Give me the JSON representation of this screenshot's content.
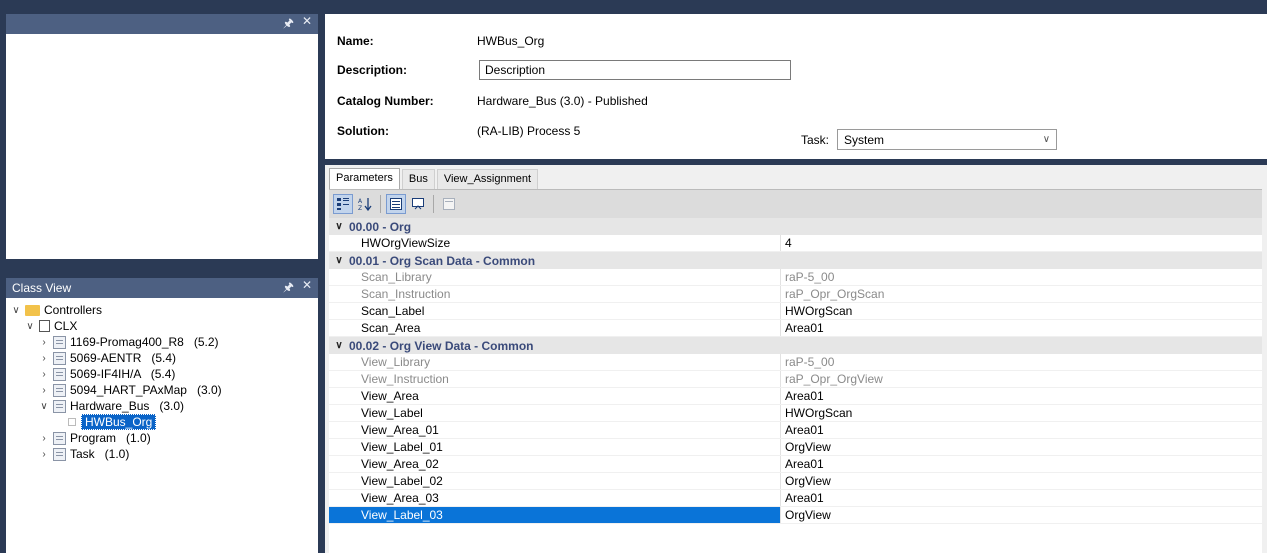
{
  "left_top_pane": {
    "pin": "ₕ",
    "close": "✕"
  },
  "class_view": {
    "title": "Class View",
    "pin": "ₕ",
    "close": "✕",
    "tree": [
      {
        "label": "Controllers",
        "level": 0,
        "expander": "∨",
        "icon": "folder-icon"
      },
      {
        "label": "CLX",
        "level": 1,
        "expander": "∨",
        "icon": "controller-icon"
      },
      {
        "label": "1169-Promag400_R8   (5.2)",
        "level": 2,
        "expander": "›",
        "icon": "module-icon"
      },
      {
        "label": "5069-AENTR   (5.4)",
        "level": 2,
        "expander": "›",
        "icon": "module-icon"
      },
      {
        "label": "5069-IF4IH/A   (5.4)",
        "level": 2,
        "expander": "›",
        "icon": "module-icon"
      },
      {
        "label": "5094_HART_PAxMap   (3.0)",
        "level": 2,
        "expander": "›",
        "icon": "module-icon"
      },
      {
        "label": "Hardware_Bus   (3.0)",
        "level": 2,
        "expander": "∨",
        "icon": "module-icon"
      },
      {
        "label": "HWBus_Org",
        "level": 3,
        "expander": "",
        "icon": "instance-icon",
        "selected": true
      },
      {
        "label": "Program   (1.0)",
        "level": 2,
        "expander": "›",
        "icon": "module-icon"
      },
      {
        "label": "Task   (1.0)",
        "level": 2,
        "expander": "›",
        "icon": "module-icon"
      }
    ]
  },
  "header": {
    "name_label": "Name:",
    "name_value": "HWBus_Org",
    "description_label": "Description:",
    "description_value": "Description",
    "catalog_label": "Catalog Number:",
    "catalog_value": "Hardware_Bus   (3.0)  - Published",
    "solution_label": "Solution:",
    "solution_value": "(RA-LIB) Process 5",
    "task_label": "Task:",
    "task_value": "System",
    "task_arrow": "∨"
  },
  "tabs": [
    "Parameters",
    "Bus",
    "View_Assignment"
  ],
  "toolbar": {
    "categorized": "∷",
    "alphabetical": "↓",
    "properties": "▤",
    "events": "↩",
    "pages": "□"
  },
  "parameters": [
    {
      "category": "00.00 - Org",
      "rows": [
        {
          "name": "HWOrgViewSize",
          "value": "4",
          "readonly": false
        }
      ]
    },
    {
      "category": "00.01 - Org Scan Data - Common",
      "rows": [
        {
          "name": "Scan_Library",
          "value": "raP-5_00",
          "readonly": true
        },
        {
          "name": "Scan_Instruction",
          "value": "raP_Opr_OrgScan",
          "readonly": true
        },
        {
          "name": "Scan_Label",
          "value": "HWOrgScan",
          "readonly": false
        },
        {
          "name": "Scan_Area",
          "value": "Area01",
          "readonly": false
        }
      ]
    },
    {
      "category": "00.02 - Org View Data - Common",
      "rows": [
        {
          "name": "View_Library",
          "value": "raP-5_00",
          "readonly": true
        },
        {
          "name": "View_Instruction",
          "value": "raP_Opr_OrgView",
          "readonly": true
        },
        {
          "name": "View_Area",
          "value": "Area01",
          "readonly": false
        },
        {
          "name": "View_Label",
          "value": "HWOrgScan",
          "readonly": false
        },
        {
          "name": "View_Area_01",
          "value": "Area01",
          "readonly": false
        },
        {
          "name": "View_Label_01",
          "value": "OrgView",
          "readonly": false
        },
        {
          "name": "View_Area_02",
          "value": "Area01",
          "readonly": false
        },
        {
          "name": "View_Label_02",
          "value": "OrgView",
          "readonly": false
        },
        {
          "name": "View_Area_03",
          "value": "Area01",
          "readonly": false
        },
        {
          "name": "View_Label_03",
          "value": "OrgView",
          "readonly": false,
          "selected": true
        }
      ]
    }
  ]
}
